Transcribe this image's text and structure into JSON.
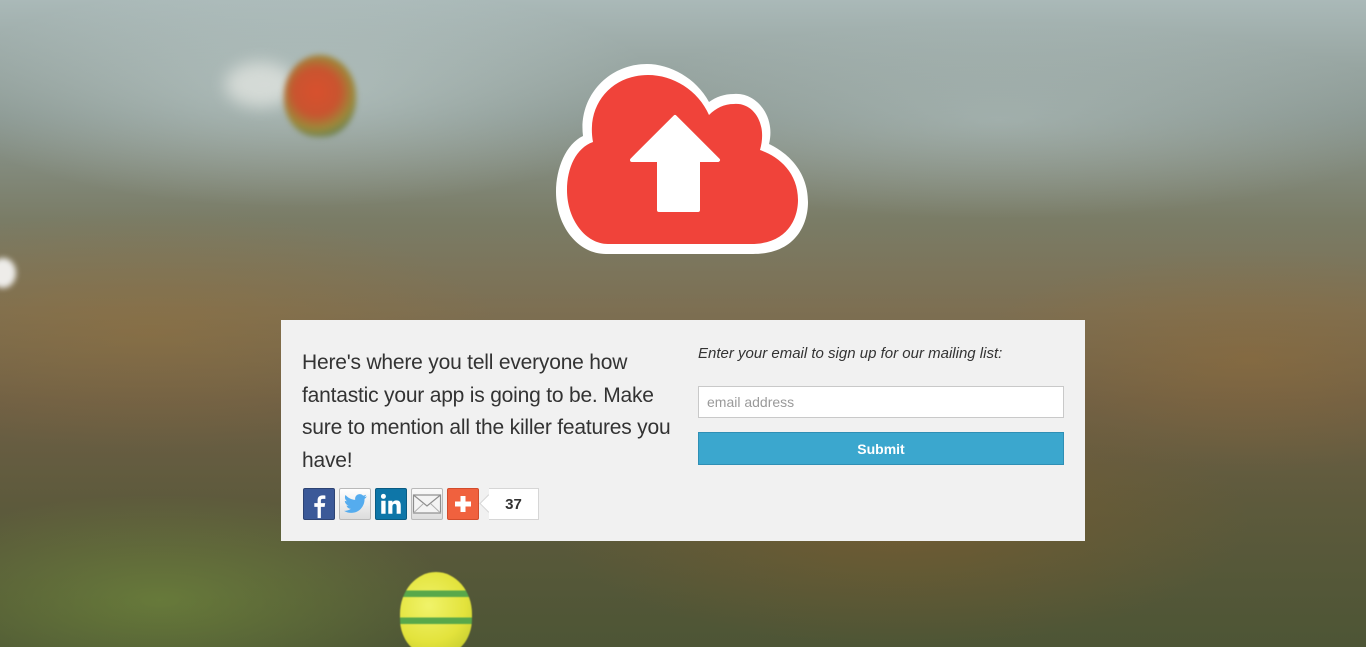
{
  "hero": {
    "logo_icon": "cloud-upload-icon",
    "logo_color": "#F0433A"
  },
  "card": {
    "pitch_text": "Here's where you tell everyone how fantastic your app is going to be. Make sure to mention all the killer features you have!",
    "signup_label": "Enter your email to sign up for our mailing list:",
    "email_placeholder": "email address",
    "email_value": "",
    "submit_label": "Submit",
    "submit_color": "#3BA7CE"
  },
  "share": {
    "buttons": [
      {
        "icon": "facebook-icon",
        "color": "#3B5998"
      },
      {
        "icon": "twitter-icon",
        "color": "#55ACEE"
      },
      {
        "icon": "linkedin-icon",
        "color": "#0E76A8"
      },
      {
        "icon": "email-icon",
        "color": "#E5E5E5"
      },
      {
        "icon": "plus-icon",
        "color": "#F0613E"
      }
    ],
    "count": "37"
  }
}
